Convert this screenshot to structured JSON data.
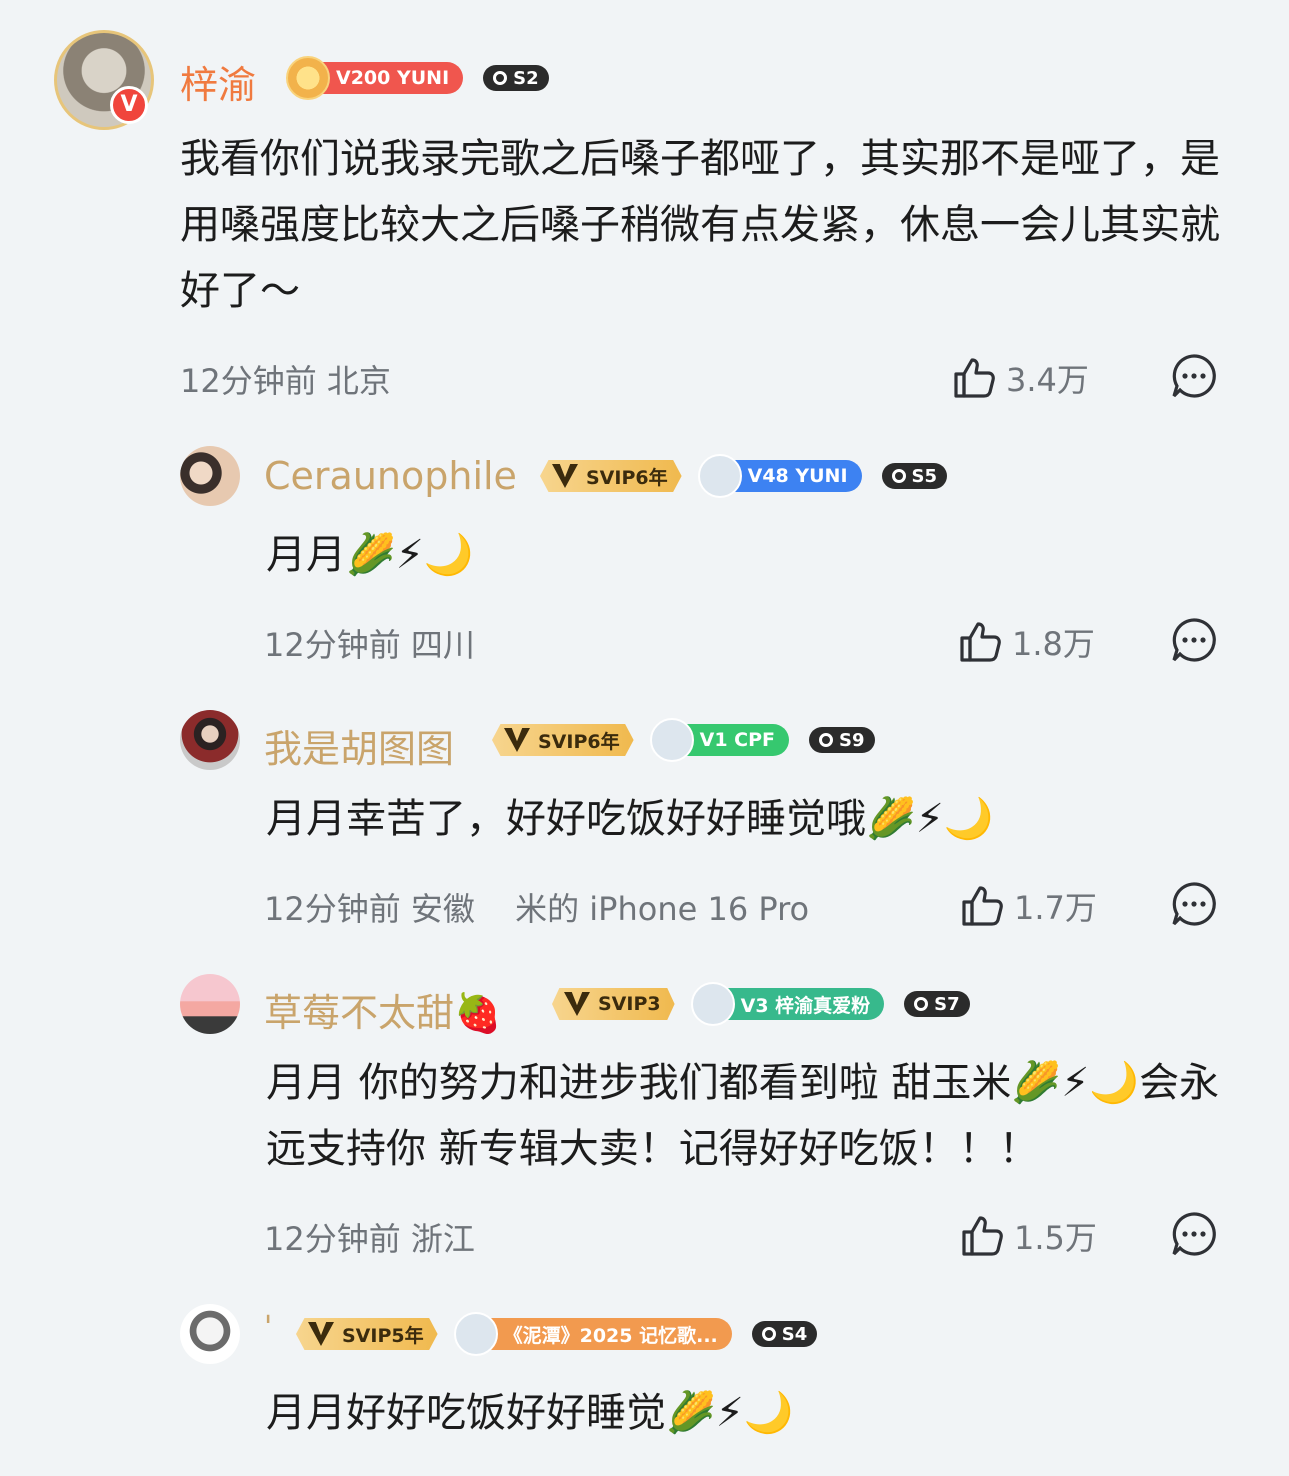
{
  "comments": [
    {
      "user": "梓渝",
      "level_badge": "V200 YUNI",
      "season_badge": "S2",
      "text": "我看你们说我录完歌之后嗓子都哑了，其实那不是哑了，是用嗓强度比较大之后嗓子稍微有点发紧，休息一会儿其实就好了～",
      "time": "12分钟前",
      "location": "北京",
      "likes": "3.4万"
    },
    {
      "user": "Ceraunophile",
      "svip": "SVIP6年",
      "level_badge": "V48 YUNI",
      "season_badge": "S5",
      "text": "月月🌽⚡🌙",
      "time": "12分钟前",
      "location": "四川",
      "likes": "1.8万"
    },
    {
      "user": "我是胡图图",
      "svip": "SVIP6年",
      "level_badge": "V1 CPF",
      "season_badge": "S9",
      "text": "月月幸苦了，好好吃饭好好睡觉哦🌽⚡🌙",
      "time": "12分钟前",
      "location": "安徽",
      "device": "米的 iPhone 16 Pro",
      "likes": "1.7万"
    },
    {
      "user": "草莓不太甜🍓",
      "svip": "SVIP3",
      "level_badge": "V3 梓渝真爱粉",
      "season_badge": "S7",
      "text": "月月 你的努力和进步我们都看到啦 甜玉米🌽⚡🌙会永远支持你 新专辑大卖！记得好好吃饭！！！",
      "time": "12分钟前",
      "location": "浙江",
      "likes": "1.5万"
    },
    {
      "user": "'",
      "svip": "SVIP5年",
      "level_badge": "《泥潭》2025 记忆歌...",
      "season_badge": "S4",
      "text": "月月好好吃饭好好睡觉🌽⚡🌙"
    }
  ],
  "colors": {
    "background": "#f1f4f6",
    "name_vip": "#c9a46b",
    "name_main": "#f07a3f",
    "meta": "#6f747a"
  },
  "icons": [
    "thumbs-up-icon",
    "comment-bubble-icon",
    "verified-v-icon"
  ]
}
